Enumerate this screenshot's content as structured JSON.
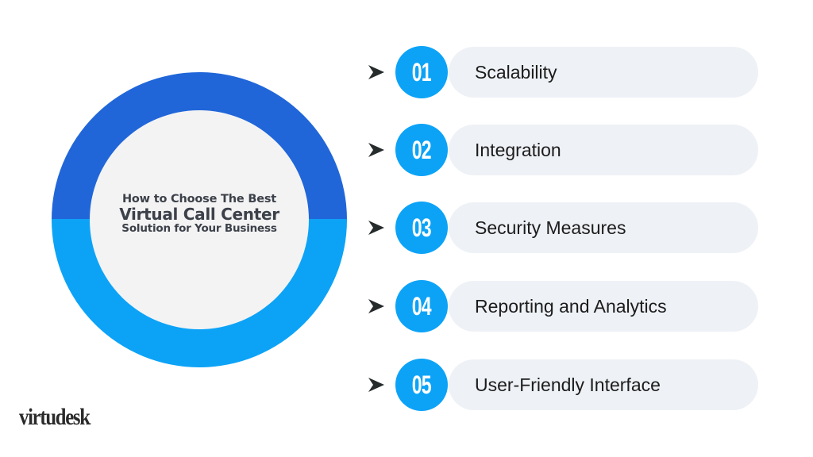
{
  "colors": {
    "ring_top": "#2066d9",
    "ring_bottom": "#0ca3f7",
    "number_badge": "#0ca3f7",
    "pill_bg": "#eef1f5",
    "arrow": "#262b2b"
  },
  "center": {
    "line1": "How to Choose The Best",
    "line2": "Virtual Call Center",
    "line3": "Solution for Your Business"
  },
  "items": [
    {
      "number": "01",
      "label": "Scalability",
      "icon": "arrow-right-icon"
    },
    {
      "number": "02",
      "label": "Integration",
      "icon": "arrow-right-icon"
    },
    {
      "number": "03",
      "label": "Security Measures",
      "icon": "arrow-right-icon"
    },
    {
      "number": "04",
      "label": "Reporting and Analytics",
      "icon": "arrow-right-icon"
    },
    {
      "number": "05",
      "label": "User-Friendly Interface",
      "icon": "arrow-right-icon"
    }
  ],
  "logo": {
    "text": "virtudesk",
    "mark": "."
  }
}
